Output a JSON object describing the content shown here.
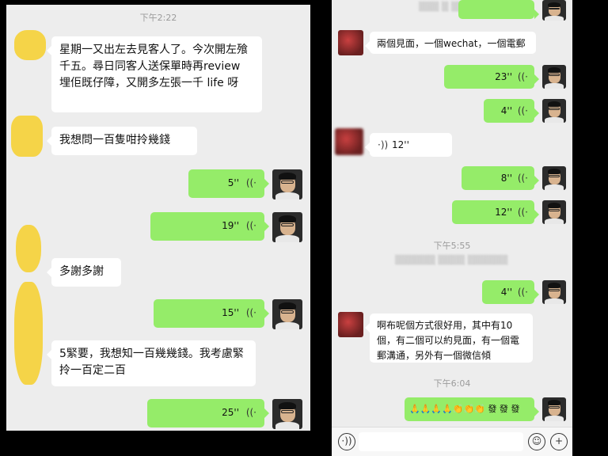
{
  "left": {
    "time_top": "下午2:22",
    "messages": [
      {
        "text": "星期一又出左去見客人了。今次開左飱千五。尋日同客人送保單時再review 埋佢既仔障，又開多左張一千 life 呀"
      },
      {
        "text": "我想問一百隻咁拎幾錢"
      },
      {
        "voice": "5''"
      },
      {
        "voice": "19''"
      },
      {
        "text": "多謝多謝"
      },
      {
        "voice": "15''"
      },
      {
        "text": "5緊要，我想知一百幾幾錢。我考慮緊拎一百定二百"
      },
      {
        "voice": "25''"
      }
    ]
  },
  "right": {
    "messages": [
      {
        "text": "兩個見面，一個wechat，一個電郵"
      },
      {
        "voice": "23''"
      },
      {
        "voice": "4''"
      },
      {
        "voice_in": "12''"
      },
      {
        "voice": "8''"
      },
      {
        "voice": "12''"
      },
      {
        "time": "下午5:55"
      },
      {
        "voice": "4''"
      },
      {
        "text": "啊布呢個方式很好用，其中有10個，有二個可以約見面，有一個電郵溝通，另外有一個微信傾"
      },
      {
        "time": "下午6:04"
      },
      {
        "emoji": "🙏🙏🙏🙏👏👏👏 發 發 發"
      }
    ],
    "toolbar": {
      "voice_icon": "voice-icon",
      "emoji_icon": "smile-icon",
      "plus_icon": "plus-icon"
    }
  },
  "icons": {
    "wave": "wave-icon"
  }
}
